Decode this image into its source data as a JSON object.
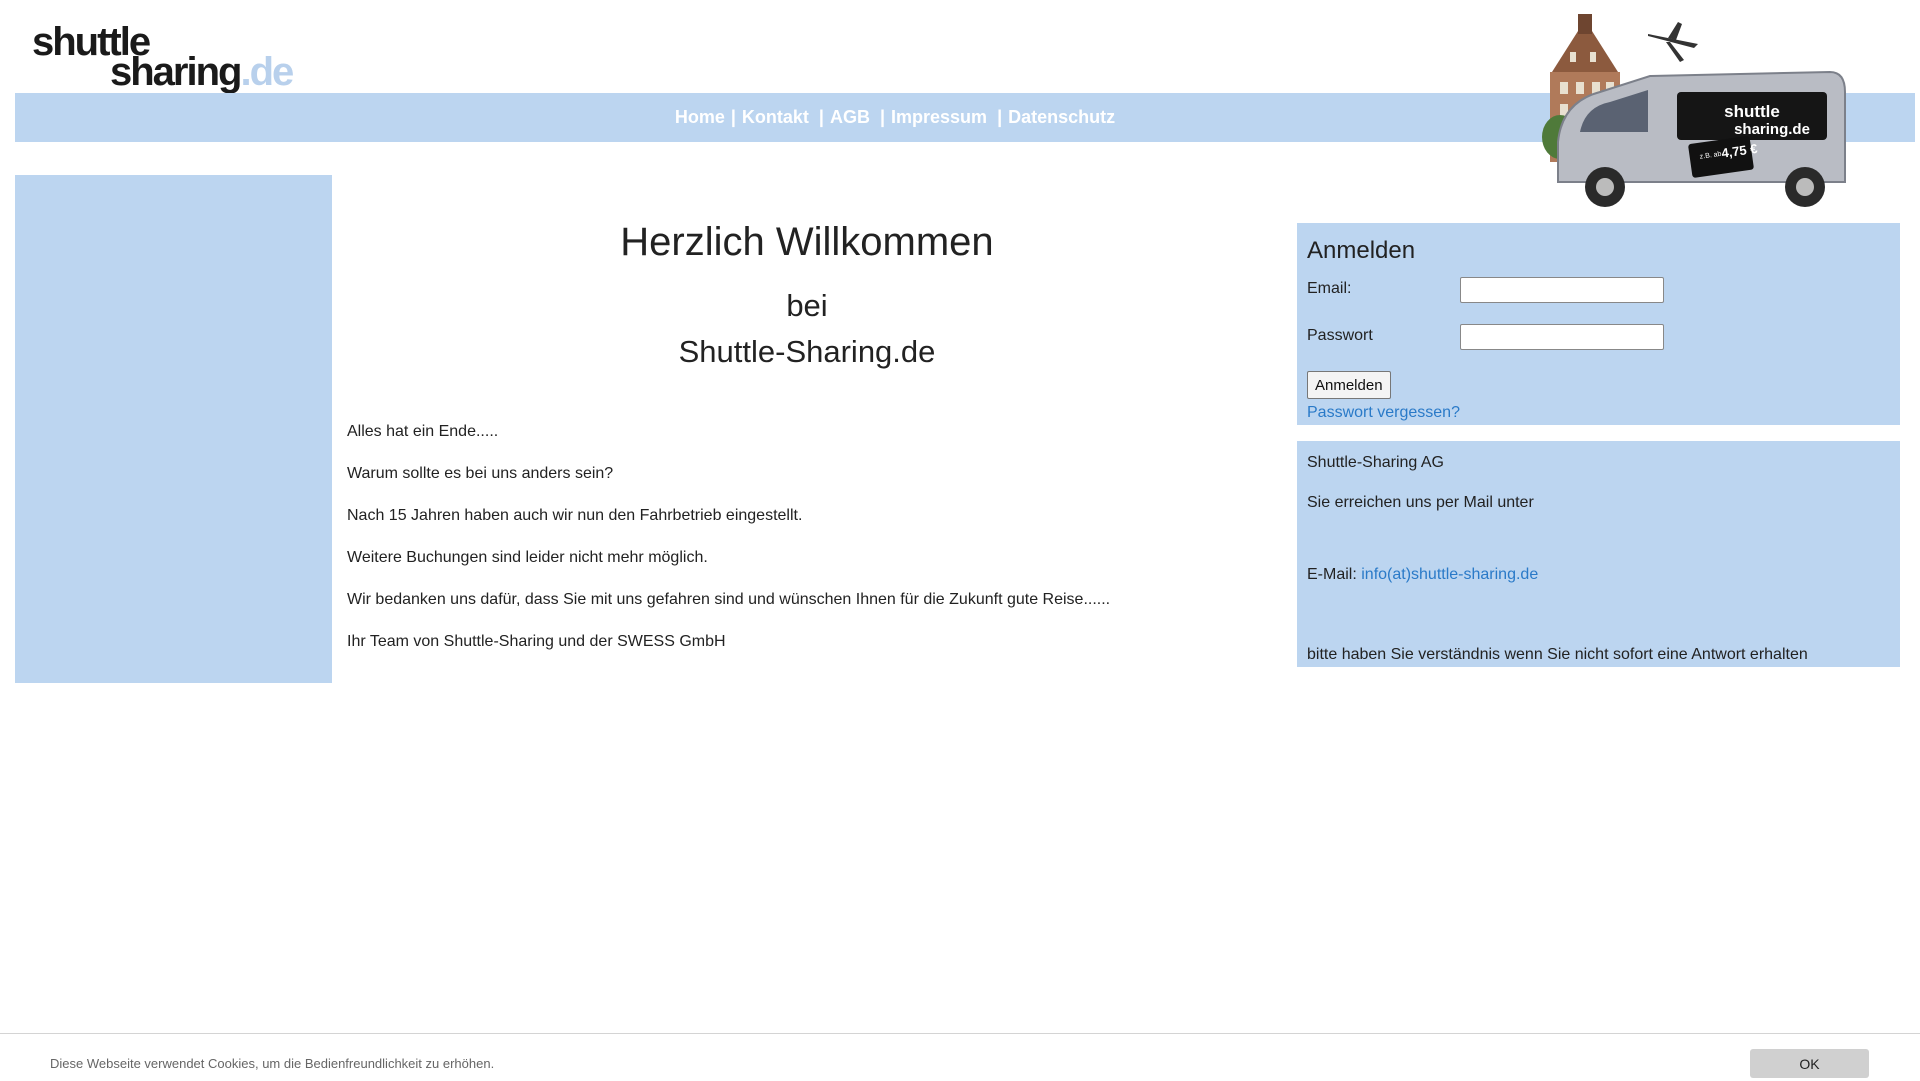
{
  "logo": {
    "line1": "shuttle",
    "line2": "sharing",
    "tld": ".de"
  },
  "nav": {
    "items": [
      {
        "label": "Home"
      },
      {
        "label": "Kontakt"
      },
      {
        "label": "AGB"
      },
      {
        "label": "Impressum"
      },
      {
        "label": "Datenschutz"
      }
    ],
    "separator": "|"
  },
  "hero": {
    "van_brand_line1": "shuttle",
    "van_brand_line2": "sharing.de",
    "van_price": "4,75 €",
    "van_price_prefix": "z.B. ab"
  },
  "main": {
    "title": "Herzlich Willkommen",
    "sub1": "bei",
    "sub2": "Shuttle-Sharing.de",
    "paragraphs": [
      "Alles hat ein Ende.....",
      "Warum sollte es bei uns anders sein?",
      "Nach 15 Jahren haben auch wir nun den Fahrbetrieb eingestellt.",
      "Weitere Buchungen sind leider nicht mehr möglich.",
      "Wir bedanken uns dafür, dass Sie mit uns gefahren sind und wünschen Ihnen für die Zukunft gute Reise......",
      "Ihr Team von Shuttle-Sharing und der SWESS GmbH"
    ]
  },
  "login": {
    "title": "Anmelden",
    "email_label": "Email:",
    "email_value": "",
    "password_label": "Passwort",
    "password_value": "",
    "submit_label": "Anmelden",
    "forgot_label": "Passwort vergessen?"
  },
  "contact": {
    "company": "Shuttle-Sharing AG",
    "reach_text": "Sie erreichen uns per Mail unter",
    "email_prefix": "E-Mail:",
    "email": "info(at)shuttle-sharing.de",
    "note": "bitte haben Sie verständnis wenn Sie nicht sofort eine Antwort erhalten"
  },
  "cookie": {
    "message": "Diese Webseite verwendet Cookies, um die Bedienfreundlichkeit zu erhöhen.",
    "ok_label": "OK"
  },
  "colors": {
    "panel_blue": "#bcd5f0",
    "link_blue": "#2a7ac8"
  }
}
